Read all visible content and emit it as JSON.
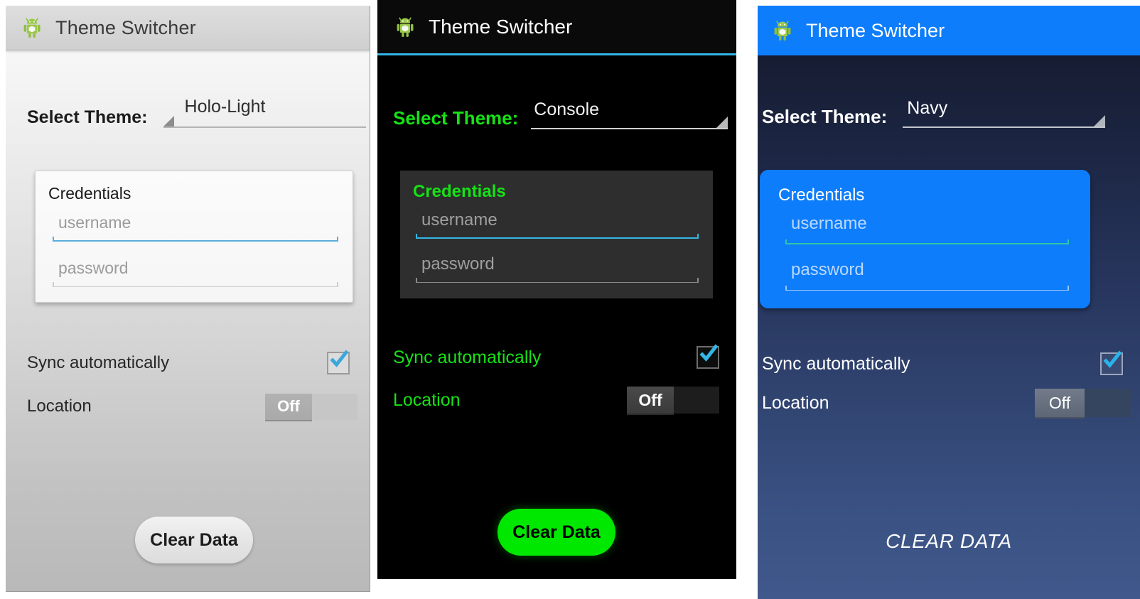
{
  "app": {
    "title": "Theme Switcher",
    "icon": "android-robot-icon"
  },
  "labels": {
    "select_theme": "Select Theme:",
    "credentials": "Credentials",
    "username_placeholder": "username",
    "password_placeholder": "password",
    "sync": "Sync automatically",
    "location": "Location",
    "switch_off": "Off"
  },
  "panels": [
    {
      "id": "holo-light",
      "theme_name": "Holo-Light",
      "title": "Theme Switcher",
      "select_theme_label": "Select Theme:",
      "spinner_value": "Holo-Light",
      "card_title": "Credentials",
      "username_placeholder": "username",
      "password_placeholder": "password",
      "sync_label": "Sync automatically",
      "sync_checked": true,
      "location_label": "Location",
      "location_state": "Off",
      "button_label": "Clear Data",
      "colors": {
        "titlebar": "#d6d6d6",
        "title_text": "#3a3a3a",
        "background_top": "#fbfbfb",
        "background_bottom": "#b9b9b9",
        "accent": "#5badde",
        "card": "#f8f8f8",
        "body_text": "#1c1c1c",
        "button_bg": "#e6e6e6",
        "button_text": "#1d1d1d"
      }
    },
    {
      "id": "console",
      "theme_name": "Console",
      "title": "Theme Switcher",
      "select_theme_label": "Select Theme:",
      "spinner_value": "Console",
      "card_title": "Credentials",
      "username_placeholder": "username",
      "password_placeholder": "password",
      "sync_label": "Sync automatically",
      "sync_checked": true,
      "location_label": "Location",
      "location_state": "Off",
      "button_label": "Clear Data",
      "colors": {
        "titlebar": "#0a0a0a",
        "title_text": "#ffffff",
        "titlebar_underline": "#33b5e5",
        "background": "#000000",
        "accent": "#16e216",
        "card": "#2e2e2e",
        "body_text": "#16e216",
        "button_bg": "#00e800",
        "button_text": "#000000"
      }
    },
    {
      "id": "navy",
      "theme_name": "Navy",
      "title": "Theme Switcher",
      "select_theme_label": "Select Theme:",
      "spinner_value": "Navy",
      "card_title": "Credentials",
      "username_placeholder": "username",
      "password_placeholder": "password",
      "sync_label": "Sync automatically",
      "sync_checked": true,
      "location_label": "Location",
      "location_state": "Off",
      "button_label": "CLEAR DATA",
      "colors": {
        "titlebar": "#0d7dfc",
        "title_text": "#ffffff",
        "background_top": "#13182a",
        "background_bottom": "#41588c",
        "accent": "#0d7dfc",
        "card": "#0d7dfc",
        "body_text": "#ffffff",
        "button_text": "#ffffff"
      }
    }
  ]
}
